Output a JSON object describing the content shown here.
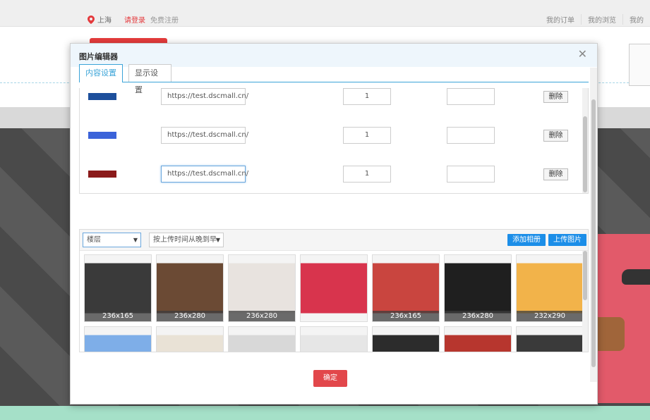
{
  "background": {
    "location": "上海",
    "login_link": "请登录",
    "register_link": "免费注册",
    "top_links": [
      "我的订单",
      "我的浏览",
      "我的"
    ]
  },
  "dialog": {
    "title": "图片编辑器",
    "tabs": [
      {
        "label": "内容设置",
        "active": true
      },
      {
        "label": "显示设置",
        "active": false
      }
    ],
    "rows": [
      {
        "url": "https://test.dscmall.cn/",
        "sort": "1",
        "delete_label": "删除",
        "thumb_color": "#1d4f9c"
      },
      {
        "url": "https://test.dscmall.cn/",
        "sort": "1",
        "delete_label": "删除",
        "thumb_color": "#3b63d9"
      },
      {
        "url": "https://test.dscmall.cn/",
        "sort": "1",
        "delete_label": "删除",
        "thumb_color": "#8b1a1a"
      }
    ],
    "gallery": {
      "folder_select": "楼层",
      "sort_select": "按上传时间从晚到早",
      "add_album_label": "添加相册",
      "upload_label": "上传图片",
      "images": [
        {
          "size": "236x165",
          "color": "#3a3a3a"
        },
        {
          "size": "236x280",
          "color": "#6b4a34"
        },
        {
          "size": "236x280",
          "color": "#e8e3df"
        },
        {
          "size": "",
          "color": "#d8344d"
        },
        {
          "size": "236x165",
          "color": "#c9453f"
        },
        {
          "size": "236x280",
          "color": "#1f1f1f"
        },
        {
          "size": "232x290",
          "color": "#f2b34a"
        },
        {
          "size": "",
          "color": "#7eaee8"
        },
        {
          "size": "",
          "color": "#e9e2d6"
        },
        {
          "size": "",
          "color": "#d8d8d8"
        },
        {
          "size": "",
          "color": "#e6e6e6"
        },
        {
          "size": "",
          "color": "#2c2c2c"
        },
        {
          "size": "",
          "color": "#b7362e"
        },
        {
          "size": "",
          "color": "#3a3a3a"
        }
      ]
    },
    "confirm_label": "确定"
  }
}
